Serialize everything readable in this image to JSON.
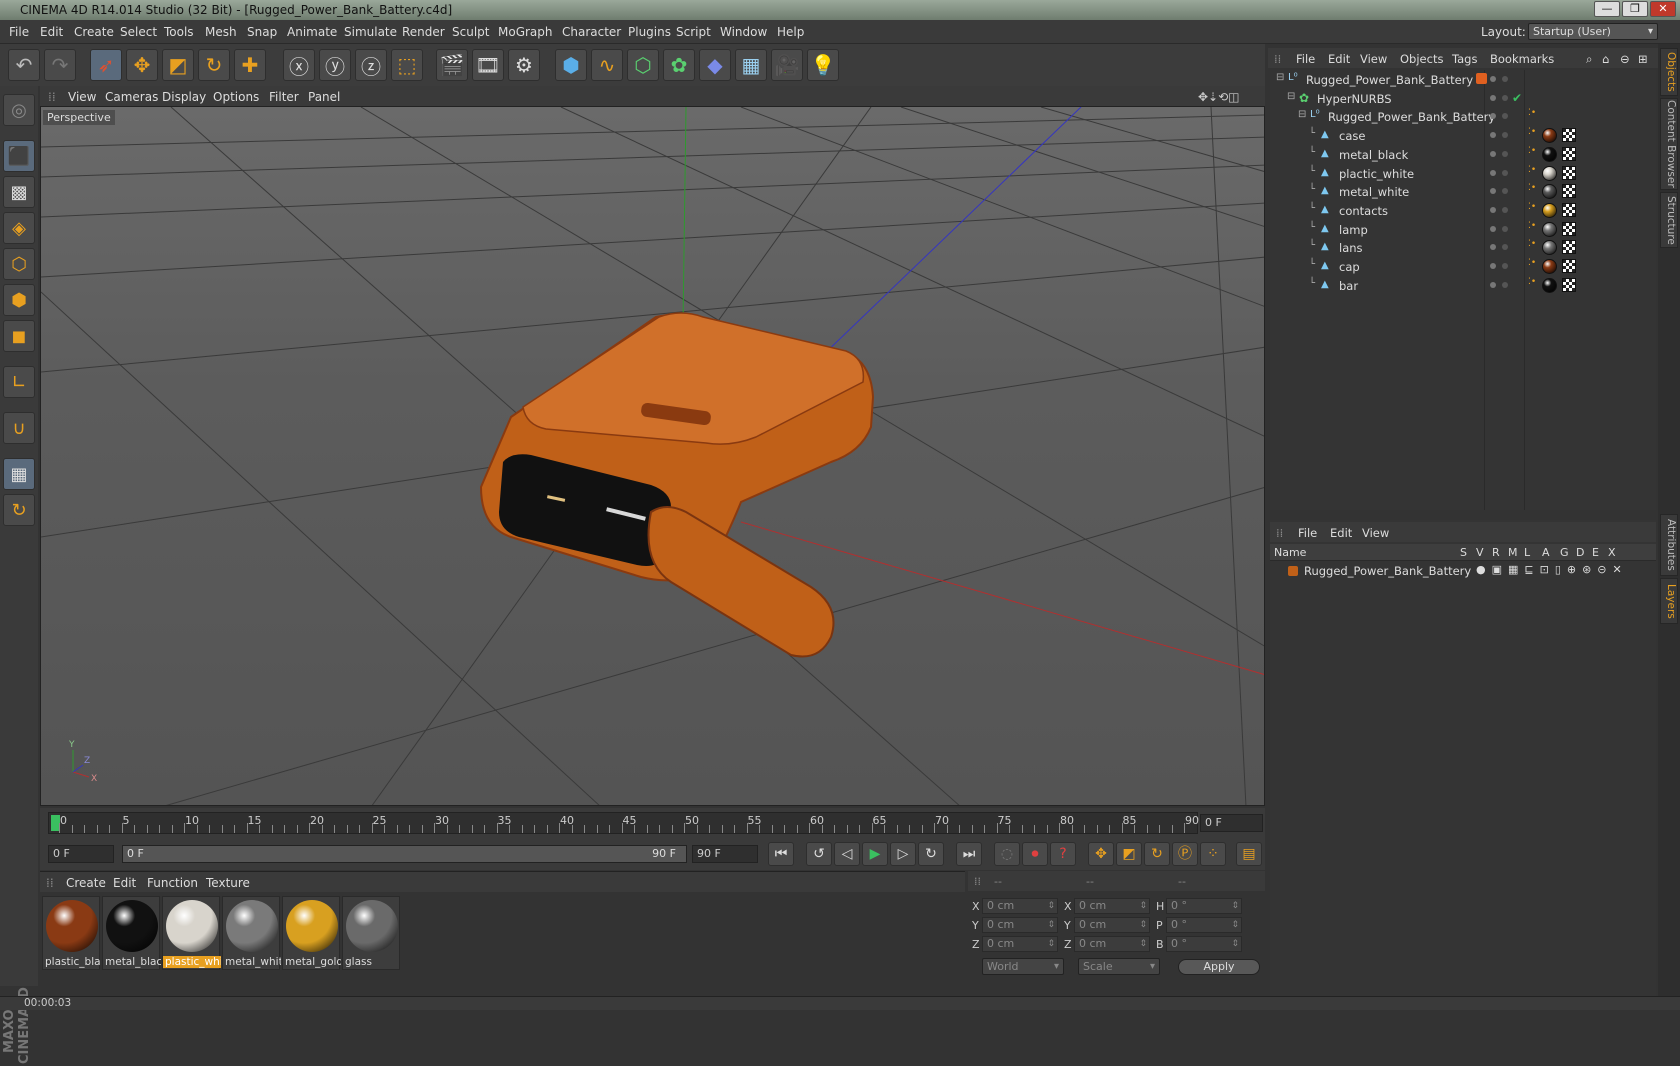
{
  "window": {
    "title": "CINEMA 4D R14.014 Studio (32 Bit) - [Rugged_Power_Bank_Battery.c4d]",
    "minimize": "—",
    "restore": "❐",
    "close": "✕"
  },
  "menu": [
    "File",
    "Edit",
    "Create",
    "Select",
    "Tools",
    "Mesh",
    "Snap",
    "Animate",
    "Simulate",
    "Render",
    "Sculpt",
    "MoGraph",
    "Character",
    "Plugins",
    "Script",
    "Window",
    "Help"
  ],
  "layout": {
    "label": "Layout:",
    "value": "Startup (User)"
  },
  "viewport": {
    "menu": [
      "View",
      "Cameras",
      "Display",
      "Options",
      "Filter",
      "Panel"
    ],
    "label": "Perspective",
    "axis": {
      "x": "X",
      "y": "Y",
      "z": "Z"
    }
  },
  "timeline": {
    "ticks": [
      "0",
      "5",
      "10",
      "15",
      "20",
      "25",
      "30",
      "35",
      "40",
      "45",
      "50",
      "55",
      "60",
      "65",
      "70",
      "75",
      "80",
      "85",
      "90"
    ],
    "current": "0 F",
    "start": "0 F",
    "range_start": "0 F",
    "range_end": "90 F",
    "end": "90 F"
  },
  "materials": {
    "menu": [
      "Create",
      "Edit",
      "Function",
      "Texture"
    ],
    "items": [
      {
        "label": "plastic_blac",
        "color": "#8a3a14"
      },
      {
        "label": "metal_black",
        "color": "#111111"
      },
      {
        "label": "plastic_whi",
        "color": "#d8d4cc"
      },
      {
        "label": "metal_whit",
        "color": "#7a7a7a"
      },
      {
        "label": "metal_gold",
        "color": "#d8a020"
      },
      {
        "label": "glass",
        "color": "#6a6a6a"
      }
    ]
  },
  "coords": {
    "header": [
      "--",
      "--",
      "--"
    ],
    "rows": [
      {
        "a": "X",
        "av": "0 cm",
        "b": "X",
        "bv": "0 cm",
        "c": "H",
        "cv": "0 °"
      },
      {
        "a": "Y",
        "av": "0 cm",
        "b": "Y",
        "bv": "0 cm",
        "c": "P",
        "cv": "0 °"
      },
      {
        "a": "Z",
        "av": "0 cm",
        "b": "Z",
        "bv": "0 cm",
        "c": "B",
        "cv": "0 °"
      }
    ],
    "space": "World",
    "mode": "Scale",
    "apply": "Apply"
  },
  "status": {
    "time": "00:00:03"
  },
  "objects": {
    "menu": [
      "File",
      "Edit",
      "View",
      "Objects",
      "Tags",
      "Bookmarks"
    ],
    "tree": [
      {
        "name": "Rugged_Power_Bank_Battery",
        "indent": 0,
        "icon": "null-icon"
      },
      {
        "name": "HyperNURBS",
        "indent": 1,
        "icon": "hypernurbs-icon"
      },
      {
        "name": "Rugged_Power_Bank_Battery",
        "indent": 2,
        "icon": "null-icon"
      },
      {
        "name": "case",
        "indent": 3,
        "icon": "polygon-icon",
        "mat": "#8a3a14"
      },
      {
        "name": "metal_black",
        "indent": 3,
        "icon": "polygon-icon",
        "mat": "#111111"
      },
      {
        "name": "plactic_white",
        "indent": 3,
        "icon": "polygon-icon",
        "mat": "#d8d4cc"
      },
      {
        "name": "metal_white",
        "indent": 3,
        "icon": "polygon-icon",
        "mat": "#5a5a5a"
      },
      {
        "name": "contacts",
        "indent": 3,
        "icon": "polygon-icon",
        "mat": "#d8a020"
      },
      {
        "name": "lamp",
        "indent": 3,
        "icon": "polygon-icon",
        "mat": "#777777"
      },
      {
        "name": "lans",
        "indent": 3,
        "icon": "polygon-icon",
        "mat": "#777777"
      },
      {
        "name": "cap",
        "indent": 3,
        "icon": "polygon-icon",
        "mat": "#8a3a14"
      },
      {
        "name": "bar",
        "indent": 3,
        "icon": "polygon-icon",
        "mat": "#111111"
      }
    ]
  },
  "layers": {
    "menu": [
      "File",
      "Edit",
      "View"
    ],
    "columns": [
      "Name",
      "S",
      "V",
      "R",
      "M",
      "L",
      "A",
      "G",
      "D",
      "E",
      "X"
    ],
    "row": "Rugged_Power_Bank_Battery"
  },
  "sidetabs": [
    "Objects",
    "Content Browser",
    "Structure",
    "Attributes",
    "Layers"
  ],
  "accent": "#e8a020"
}
